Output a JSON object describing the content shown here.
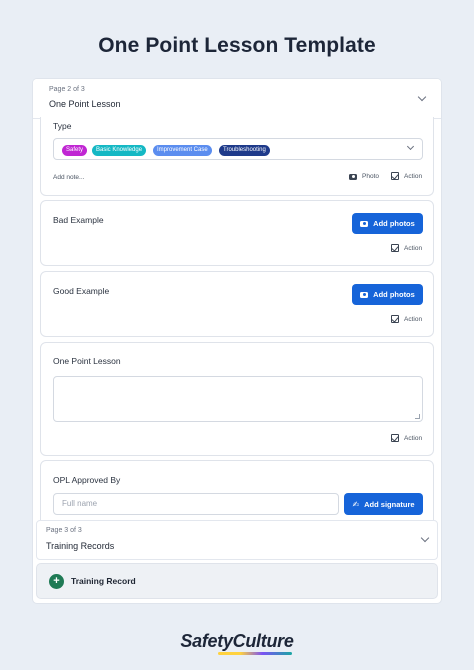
{
  "page_title": "One Point Lesson Template",
  "page2": {
    "label": "Page 2 of 3",
    "title": "One Point Lesson"
  },
  "type_question": {
    "label": "Type",
    "chips": [
      {
        "text": "Safety",
        "color": "#c026d3"
      },
      {
        "text": "Basic Knowledge",
        "color": "#14b8c4"
      },
      {
        "text": "Improvement Case",
        "color": "#5b8def"
      },
      {
        "text": "Troubleshooting",
        "color": "#1e3a8a"
      }
    ],
    "add_note": "Add note...",
    "photo": "Photo",
    "action": "Action"
  },
  "bad_example": {
    "label": "Bad Example",
    "button": "Add photos",
    "action": "Action"
  },
  "good_example": {
    "label": "Good Example",
    "button": "Add photos",
    "action": "Action"
  },
  "one_point_lesson": {
    "label": "One Point Lesson",
    "action": "Action"
  },
  "opl_approved": {
    "label": "OPL Approved By",
    "placeholder": "Full name",
    "button": "Add signature"
  },
  "page3": {
    "label": "Page 3 of 3",
    "title": "Training Records"
  },
  "training_record": {
    "label": "Training Record",
    "plus": "+"
  },
  "brand": "SafetyCulture"
}
